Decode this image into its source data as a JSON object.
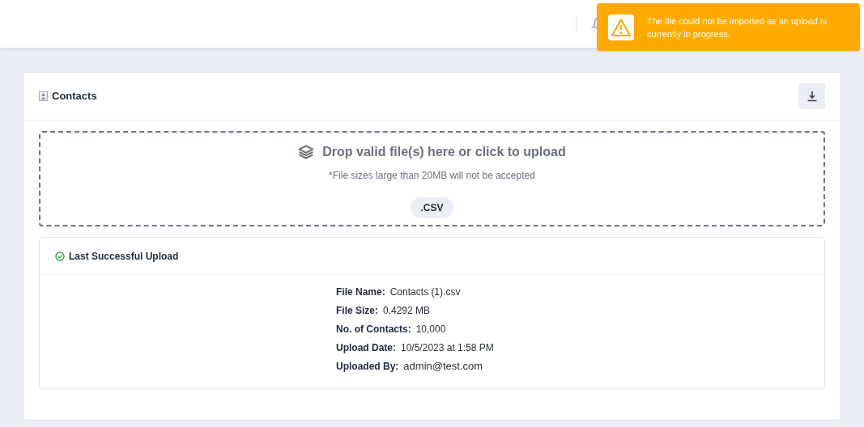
{
  "toast": {
    "message": "The file could not be imported as an upload is currently in progress."
  },
  "card": {
    "title": "Contacts"
  },
  "dropzone": {
    "title": "Drop valid file(s) here or click to upload",
    "note": "*File sizes large than 20MB will not be accepted",
    "formats": [
      ".CSV"
    ]
  },
  "last_upload": {
    "title": "Last Successful Upload",
    "fields": [
      {
        "label": "File Name:",
        "value": "Contacts (1).csv"
      },
      {
        "label": "File Size:",
        "value": "0.4292 MB"
      },
      {
        "label": "No. of Contacts:",
        "value": "10,000"
      },
      {
        "label": "Upload Date:",
        "value": "10/5/2023 at 1:58 PM"
      },
      {
        "label": "Uploaded By:",
        "value": "admin@test.com"
      }
    ]
  }
}
